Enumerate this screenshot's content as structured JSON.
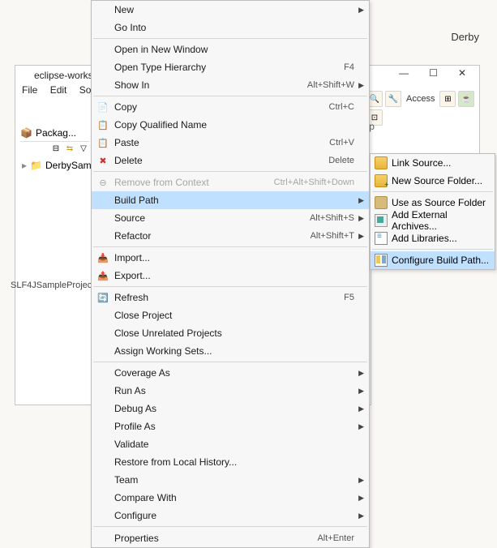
{
  "window": {
    "title": "eclipse-works",
    "menubar": [
      "File",
      "Edit",
      "Sourc"
    ]
  },
  "header_right_label": "Derby",
  "right_window": {
    "min": "—",
    "max": "☐",
    "close": "✕",
    "p_label": "p",
    "access_label": "Access"
  },
  "package_explorer": {
    "title": "Packag...",
    "project": "DerbySam"
  },
  "slf4j_label": "SLF4JSampleProjec",
  "context_menu": {
    "new": "New",
    "go_into": "Go Into",
    "open_new_window": "Open in New Window",
    "open_type_hier": "Open Type Hierarchy",
    "sc_open_type_hier": "F4",
    "show_in": "Show In",
    "sc_show_in": "Alt+Shift+W",
    "copy": "Copy",
    "sc_copy": "Ctrl+C",
    "copy_qual": "Copy Qualified Name",
    "paste": "Paste",
    "sc_paste": "Ctrl+V",
    "delete": "Delete",
    "sc_delete": "Delete",
    "remove_ctx": "Remove from Context",
    "sc_remove_ctx": "Ctrl+Alt+Shift+Down",
    "build_path": "Build Path",
    "source": "Source",
    "sc_source": "Alt+Shift+S",
    "refactor": "Refactor",
    "sc_refactor": "Alt+Shift+T",
    "import": "Import...",
    "export": "Export...",
    "refresh": "Refresh",
    "sc_refresh": "F5",
    "close_project": "Close Project",
    "close_unrelated": "Close Unrelated Projects",
    "assign_ws": "Assign Working Sets...",
    "coverage_as": "Coverage As",
    "run_as": "Run As",
    "debug_as": "Debug As",
    "profile_as": "Profile As",
    "validate": "Validate",
    "restore_local": "Restore from Local History...",
    "team": "Team",
    "compare_with": "Compare With",
    "configure": "Configure",
    "properties": "Properties",
    "sc_properties": "Alt+Enter"
  },
  "buildpath_submenu": {
    "link_source": "Link Source...",
    "new_source_folder": "New Source Folder...",
    "use_as_source": "Use as Source Folder",
    "add_ext_archives": "Add External Archives...",
    "add_libraries": "Add Libraries...",
    "configure_bp": "Configure Build Path..."
  }
}
